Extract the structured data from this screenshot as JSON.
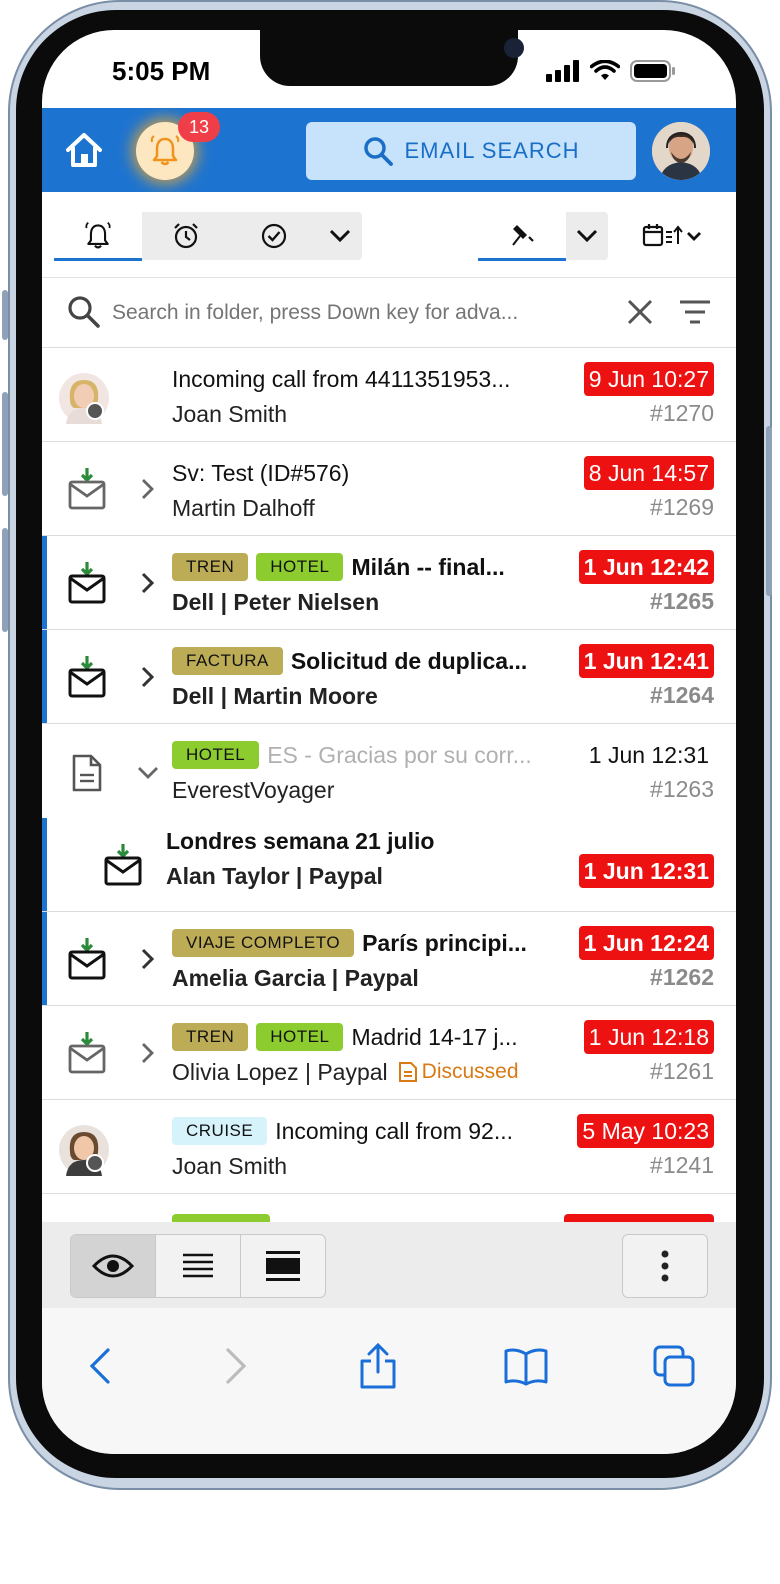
{
  "status_bar": {
    "time": "5:05 PM"
  },
  "header": {
    "notification_count": "13",
    "email_search_label": "EMAIL SEARCH",
    "accent_color": "#1d74d0"
  },
  "search": {
    "placeholder": "Search in folder, press Down key for adva..."
  },
  "messages": [
    {
      "subject": "Incoming call from 4411351953...",
      "from": "Joan Smith",
      "date": "9 Jun 10:27",
      "num": "#1270",
      "icon": "avatar-woman-icon"
    },
    {
      "subject": "Sv: Test (ID#576)",
      "from": "Martin Dalhoff",
      "date": "8 Jun 14:57",
      "num": "#1269",
      "icon": "mail-inbox-icon"
    },
    {
      "tags": [
        "TREN",
        "HOTEL"
      ],
      "subject": "Milán -- final...",
      "from": "Dell | Peter Nielsen",
      "date": "1 Jun 12:42",
      "num": "#1265",
      "icon": "mail-inbox-icon"
    },
    {
      "tags": [
        "FACTURA"
      ],
      "subject": "Solicitud de duplica...",
      "from": "Dell | Martin Moore",
      "date": "1 Jun 12:41",
      "num": "#1264",
      "icon": "mail-inbox-icon"
    },
    {
      "tags": [
        "HOTEL"
      ],
      "subject": "ES - Gracias por su corr...",
      "from": "EverestVoyager",
      "date": "1 Jun 12:31",
      "num": "#1263",
      "icon": "document-icon"
    },
    {
      "subject": "Londres semana 21 julio",
      "from": "Alan Taylor | Paypal",
      "date": "1 Jun 12:31",
      "icon": "mail-inbox-icon"
    },
    {
      "tags": [
        "VIAJE COMPLETO"
      ],
      "subject": "París principi...",
      "from": "Amelia Garcia | Paypal",
      "date": "1 Jun 12:24",
      "num": "#1262",
      "icon": "mail-inbox-icon"
    },
    {
      "tags": [
        "TREN",
        "HOTEL"
      ],
      "subject": "Madrid 14-17 j...",
      "from": "Olivia Lopez | Paypal",
      "status": "Discussed",
      "date": "1 Jun 12:18",
      "num": "#1261",
      "icon": "mail-inbox-icon"
    },
    {
      "tags": [
        "CRUISE"
      ],
      "subject": "Incoming call from 92...",
      "from": "Joan Smith",
      "date": "5 May 10:23",
      "num": "#1241",
      "icon": "avatar-woman-icon"
    }
  ],
  "colors": {
    "date_badge": "#ee1111",
    "tag_olive": "#bdac56",
    "tag_green": "#8ccc2e",
    "tag_cyan": "#d6f3fb",
    "unread_bar": "#1d74d0"
  }
}
